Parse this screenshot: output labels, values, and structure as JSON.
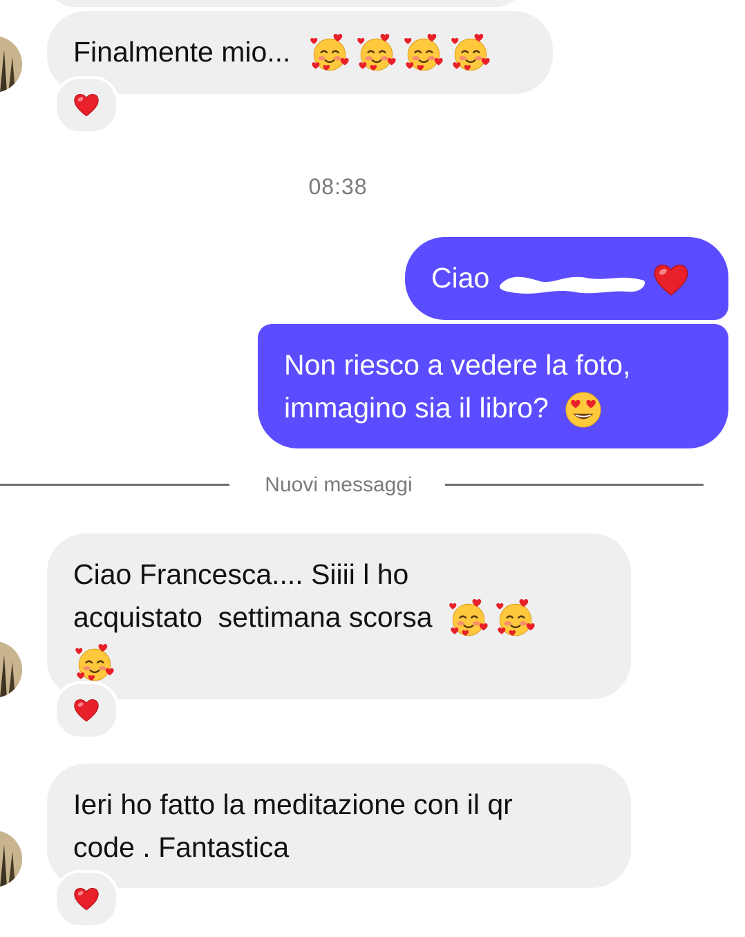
{
  "conversation": {
    "messages": [
      {
        "id": "m1",
        "direction": "incoming",
        "text": "Finalmente mio...",
        "emojis": [
          "smiling-face-with-hearts",
          "smiling-face-with-hearts",
          "smiling-face-with-hearts",
          "smiling-face-with-hearts"
        ],
        "reaction": "red-heart"
      },
      {
        "id": "m2",
        "direction": "outgoing",
        "text": "Ciao",
        "redacted_name": true,
        "emojis": [
          "red-heart"
        ]
      },
      {
        "id": "m3",
        "direction": "outgoing",
        "line1": "Non riesco a vedere la foto,",
        "line2": "immagino sia il libro?",
        "emojis": [
          "smiling-face-with-heart-eyes"
        ]
      },
      {
        "id": "m4",
        "direction": "incoming",
        "line1": "Ciao Francesca.... Siiii l ho",
        "line2": "acquistato  settimana scorsa",
        "emojis": [
          "smiling-face-with-hearts",
          "smiling-face-with-hearts",
          "smiling-face-with-hearts"
        ],
        "reaction": "red-heart"
      },
      {
        "id": "m5",
        "direction": "incoming",
        "line1": "Ieri ho fatto la meditazione con il qr",
        "line2": "code . Fantastica",
        "reaction": "red-heart"
      }
    ],
    "timestamp": "08:38",
    "new_messages_label": "Nuovi messaggi"
  },
  "colors": {
    "outgoing_bubble": "#5b4dff",
    "incoming_bubble": "#efefef",
    "heart": "#e8202a",
    "muted_text": "#7a7a7a"
  }
}
